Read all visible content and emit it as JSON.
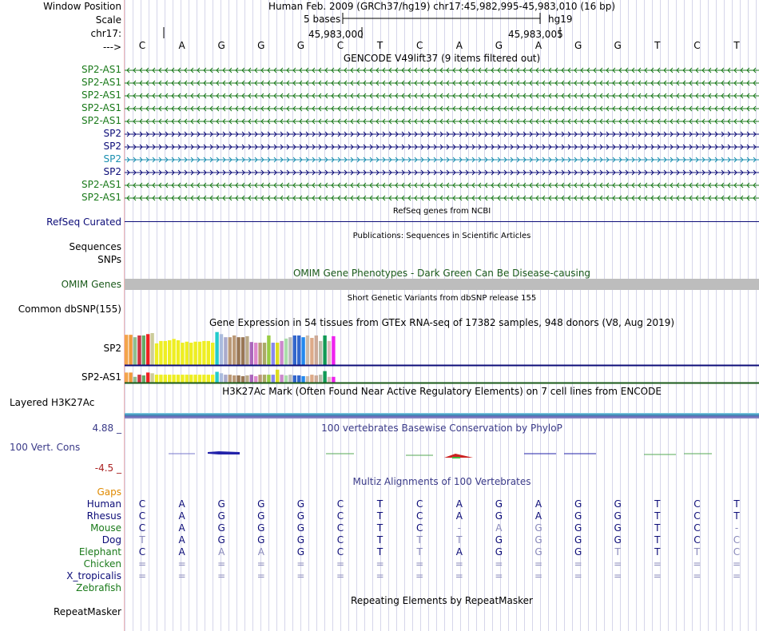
{
  "header": {
    "window_position_label": "Window Position",
    "scale_label": "Scale",
    "chr_label": "chr17:",
    "arrow_label": "--->",
    "assembly_text": "Human Feb. 2009 (GRCh37/hg19)   chr17:45,982,995-45,983,010 (16 bp)",
    "scale_text": "5 bases",
    "scale_db": "hg19",
    "coord_1": "45,983,000",
    "coord_2": "45,983,005"
  },
  "sequence": [
    "C",
    "A",
    "G",
    "G",
    "G",
    "C",
    "T",
    "C",
    "A",
    "G",
    "A",
    "G",
    "G",
    "T",
    "C",
    "T"
  ],
  "gencode": {
    "title": "GENCODE V49lift37 (9 items filtered out)",
    "tracks": [
      {
        "name": "SP2-AS1",
        "color": "#1a7a1a",
        "dir": "left"
      },
      {
        "name": "SP2-AS1",
        "color": "#1a7a1a",
        "dir": "left"
      },
      {
        "name": "SP2-AS1",
        "color": "#1a7a1a",
        "dir": "left"
      },
      {
        "name": "SP2-AS1",
        "color": "#1a7a1a",
        "dir": "left"
      },
      {
        "name": "SP2-AS1",
        "color": "#1a7a1a",
        "dir": "left"
      },
      {
        "name": "SP2",
        "color": "#0c0c78",
        "dir": "right"
      },
      {
        "name": "SP2",
        "color": "#0c0c78",
        "dir": "right"
      },
      {
        "name": "SP2",
        "color": "#1a8fb0",
        "dir": "right"
      },
      {
        "name": "SP2",
        "color": "#0c0c78",
        "dir": "right"
      },
      {
        "name": "SP2-AS1",
        "color": "#1a7a1a",
        "dir": "left"
      },
      {
        "name": "SP2-AS1",
        "color": "#1a7a1a",
        "dir": "left"
      }
    ]
  },
  "refseq": {
    "title": "RefSeq genes from NCBI",
    "label": "RefSeq Curated"
  },
  "publications": {
    "title": "Publications: Sequences in Scientific Articles",
    "label1": "Sequences",
    "label2": "SNPs"
  },
  "omim": {
    "title": "OMIM Gene Phenotypes - Dark Green Can Be Disease-causing",
    "label": "OMIM Genes"
  },
  "dbsnp": {
    "title": "Short Genetic Variants from dbSNP release 155",
    "label": "Common dbSNP(155)"
  },
  "gtex": {
    "title": "Gene Expression in 54 tissues from GTEx RNA-seq of 17382 samples, 948 donors (V8, Aug 2019)",
    "label_sp2": "SP2",
    "label_sp2as1": "SP2-AS1",
    "colors": [
      "#f3a44b",
      "#f09a3a",
      "#8fbf8f",
      "#cc3344",
      "#66aa66",
      "#ee2222",
      "#cccc99",
      "#eeee22",
      "#eeee22",
      "#eeee22",
      "#eeee22",
      "#eeee22",
      "#eeee22",
      "#eeee22",
      "#eeee22",
      "#eeee22",
      "#eeee22",
      "#eeee22",
      "#eeee22",
      "#eeee22",
      "#eeee22",
      "#22cccc",
      "#aabbdd",
      "#aaaacc",
      "#bb9977",
      "#bb9977",
      "#997755",
      "#997755",
      "#bbaa88",
      "#aa66bb",
      "#dd88cc",
      "#bb9977",
      "#aaaa66",
      "#99cc44",
      "#8888ee",
      "#dddd22",
      "#cc88cc",
      "#aaddaa",
      "#bbbbbb",
      "#3366cc",
      "#3366cc",
      "#2288ee",
      "#ccbbaa",
      "#ddaa88",
      "#ccaa99",
      "#bbbbaa",
      "#119955",
      "#ddbbbb",
      "#ee22ee",
      "#eeeeee"
    ],
    "sp2_values": [
      0.88,
      0.88,
      0.81,
      0.86,
      0.86,
      0.9,
      0.93,
      0.63,
      0.7,
      0.7,
      0.72,
      0.76,
      0.72,
      0.65,
      0.68,
      0.65,
      0.68,
      0.68,
      0.7,
      0.7,
      0.65,
      0.96,
      0.9,
      0.81,
      0.81,
      0.86,
      0.81,
      0.81,
      0.84,
      0.67,
      0.65,
      0.65,
      0.65,
      0.86,
      0.65,
      0.65,
      0.7,
      0.77,
      0.81,
      0.86,
      0.86,
      0.81,
      0.86,
      0.79,
      0.86,
      0.7,
      0.86,
      0.7,
      0.84,
      0.0
    ],
    "sp2as1_values": [
      0.7,
      0.7,
      0.4,
      0.55,
      0.5,
      0.7,
      0.65,
      0.55,
      0.55,
      0.55,
      0.55,
      0.55,
      0.55,
      0.55,
      0.55,
      0.55,
      0.55,
      0.55,
      0.55,
      0.55,
      0.55,
      0.75,
      0.65,
      0.55,
      0.55,
      0.5,
      0.5,
      0.45,
      0.5,
      0.55,
      0.45,
      0.55,
      0.55,
      0.55,
      0.55,
      0.9,
      0.55,
      0.5,
      0.55,
      0.5,
      0.5,
      0.45,
      0.45,
      0.55,
      0.5,
      0.55,
      0.8,
      0.4,
      0.4,
      0.0
    ]
  },
  "h3k27ac": {
    "title": "H3K27Ac Mark (Often Found Near Active Regulatory Elements) on 7 cell lines from ENCODE",
    "label": "Layered H3K27Ac"
  },
  "phylop": {
    "title": "100 vertebrates Basewise Conservation by PhyloP",
    "label": "100 Vert. Cons",
    "max": "4.88 _",
    "min": "-4.5 _"
  },
  "multiz": {
    "title": "Multiz Alignments of 100 Vertebrates",
    "gaps_label": "Gaps",
    "species": [
      {
        "name": "Human",
        "color": "#0c0c78",
        "bases": [
          "C",
          "A",
          "G",
          "G",
          "G",
          "C",
          "T",
          "C",
          "A",
          "G",
          "A",
          "G",
          "G",
          "T",
          "C",
          "T"
        ]
      },
      {
        "name": "Rhesus",
        "color": "#0c0c78",
        "bases": [
          "C",
          "A",
          "G",
          "G",
          "G",
          "C",
          "T",
          "C",
          "A",
          "G",
          "A",
          "G",
          "G",
          "T",
          "C",
          "T"
        ]
      },
      {
        "name": "Mouse",
        "color": "#1a7a1a",
        "bases": [
          "C",
          "A",
          "G",
          "G",
          "G",
          "C",
          "T",
          "C",
          "-",
          "A",
          "G",
          "G",
          "G",
          "T",
          "C",
          "-"
        ]
      },
      {
        "name": "Dog",
        "color": "#0c0c78",
        "bases": [
          "T",
          "A",
          "G",
          "G",
          "G",
          "C",
          "T",
          "T",
          "T",
          "G",
          "G",
          "G",
          "G",
          "T",
          "C",
          "C"
        ]
      },
      {
        "name": "Elephant",
        "color": "#1a7a1a",
        "bases": [
          "C",
          "A",
          "A",
          "A",
          "G",
          "C",
          "T",
          "T",
          "A",
          "G",
          "G",
          "G",
          "T",
          "T",
          "T",
          "C"
        ]
      },
      {
        "name": "Chicken",
        "color": "#1a7a1a",
        "bases": [
          "=",
          "=",
          "=",
          "=",
          "=",
          "=",
          "=",
          "=",
          "=",
          "=",
          "=",
          "=",
          "=",
          "=",
          "=",
          "="
        ]
      },
      {
        "name": "X_tropicalis",
        "color": "#0c0c78",
        "bases": [
          "=",
          "=",
          "=",
          "=",
          "=",
          "=",
          "=",
          "=",
          "=",
          "=",
          "=",
          "=",
          "=",
          "=",
          "=",
          "="
        ]
      },
      {
        "name": "Zebrafish",
        "color": "#1a7a1a",
        "bases": []
      }
    ]
  },
  "repeatmasker": {
    "title": "Repeating Elements by RepeatMasker",
    "label": "RepeatMasker"
  }
}
